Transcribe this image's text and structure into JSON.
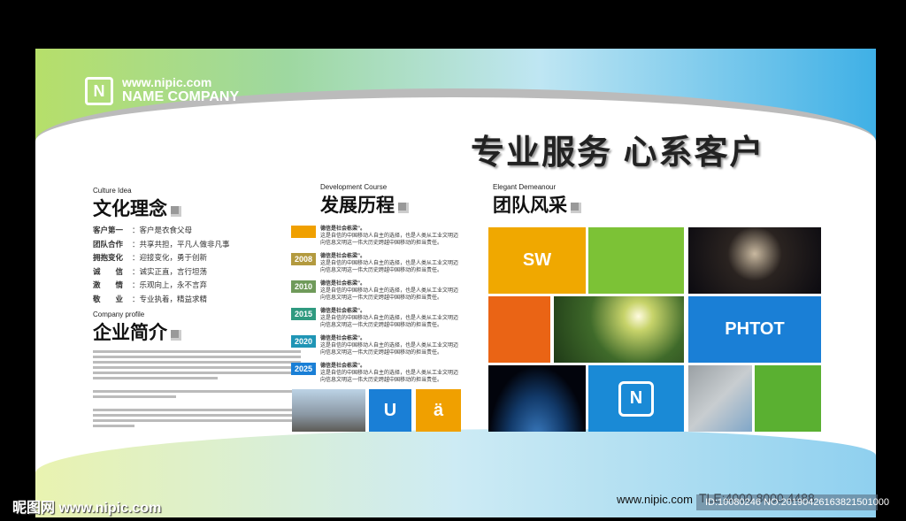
{
  "header": {
    "url": "www.nipic.com",
    "company": "NAME COMPANY",
    "logo_letter": "N",
    "slogan": "专业服务 心系客户"
  },
  "culture": {
    "en": "Culture Idea",
    "title": "文化理念",
    "items": [
      {
        "k": "客户第一",
        "v": "：客户是衣食父母"
      },
      {
        "k": "团队合作",
        "v": "：共享共担，平凡人做非凡事"
      },
      {
        "k": "拥抱变化",
        "v": "：迎接变化，勇于创新"
      },
      {
        "k": "诚　　信",
        "v": "：诚实正直，言行坦荡"
      },
      {
        "k": "激　　情",
        "v": "：乐观向上，永不言弃"
      },
      {
        "k": "敬　　业",
        "v": "：专业执着，精益求精"
      }
    ]
  },
  "profile": {
    "en": "Company profile",
    "title": "企业简介"
  },
  "course": {
    "en": "Development Course",
    "title": "发展历程",
    "items": [
      {
        "year": "",
        "color": "#f0a000",
        "head": "德信是社会栋梁”。",
        "body": "这是自信的中国移动人自主的选择，也是人类从工业文明迈向信息文明这一伟大历史跨越中国移动的担当责任。"
      },
      {
        "year": "2008",
        "color": "#b39a3f",
        "head": "德信是社会栋梁”。",
        "body": "这是自信的中国移动人自主的选择，也是人类从工业文明迈向信息文明这一伟大历史跨越中国移动的担当责任。"
      },
      {
        "year": "2010",
        "color": "#6f9a5a",
        "head": "德信是社会栋梁”。",
        "body": "这是自信的中国移动人自主的选择，也是人类从工业文明迈向信息文明这一伟大历史跨越中国移动的担当责任。"
      },
      {
        "year": "2015",
        "color": "#2f9a80",
        "head": "德信是社会栋梁”。",
        "body": "这是自信的中国移动人自主的选择，也是人类从工业文明迈向信息文明这一伟大历史跨越中国移动的担当责任。"
      },
      {
        "year": "2020",
        "color": "#1f95b5",
        "head": "德信是社会栋梁”。",
        "body": "这是自信的中国移动人自主的选择，也是人类从工业文明迈向信息文明这一伟大历史跨越中国移动的担当责任。"
      },
      {
        "year": "2025",
        "color": "#1a7fd6",
        "head": "德信是社会栋梁”。",
        "body": "这是自信的中国移动人自主的选择，也是人类从工业文明迈向信息文明这一伟大历史跨越中国移动的担当责任。"
      }
    ],
    "tile_u": "U",
    "tile_a": "ä"
  },
  "team": {
    "en": "Elegant Demeanour",
    "title": "团队风采",
    "sw": "SW",
    "phtot": "PHTOT",
    "logo_letter": "N"
  },
  "footer": {
    "url": "www.nipic.com",
    "tel": "TLE:4000 8000 4488"
  },
  "watermark": {
    "site": "昵图网 www.nipic.com",
    "id": "ID:10080246 NO:20190426163821501000"
  }
}
